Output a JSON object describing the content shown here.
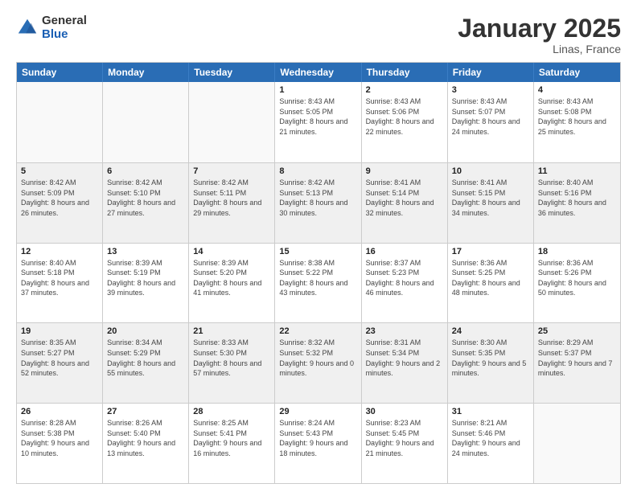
{
  "logo": {
    "general": "General",
    "blue": "Blue"
  },
  "title": {
    "month": "January 2025",
    "location": "Linas, France"
  },
  "header_days": [
    "Sunday",
    "Monday",
    "Tuesday",
    "Wednesday",
    "Thursday",
    "Friday",
    "Saturday"
  ],
  "weeks": [
    [
      {
        "day": "",
        "info": ""
      },
      {
        "day": "",
        "info": ""
      },
      {
        "day": "",
        "info": ""
      },
      {
        "day": "1",
        "info": "Sunrise: 8:43 AM\nSunset: 5:05 PM\nDaylight: 8 hours and 21 minutes."
      },
      {
        "day": "2",
        "info": "Sunrise: 8:43 AM\nSunset: 5:06 PM\nDaylight: 8 hours and 22 minutes."
      },
      {
        "day": "3",
        "info": "Sunrise: 8:43 AM\nSunset: 5:07 PM\nDaylight: 8 hours and 24 minutes."
      },
      {
        "day": "4",
        "info": "Sunrise: 8:43 AM\nSunset: 5:08 PM\nDaylight: 8 hours and 25 minutes."
      }
    ],
    [
      {
        "day": "5",
        "info": "Sunrise: 8:42 AM\nSunset: 5:09 PM\nDaylight: 8 hours and 26 minutes."
      },
      {
        "day": "6",
        "info": "Sunrise: 8:42 AM\nSunset: 5:10 PM\nDaylight: 8 hours and 27 minutes."
      },
      {
        "day": "7",
        "info": "Sunrise: 8:42 AM\nSunset: 5:11 PM\nDaylight: 8 hours and 29 minutes."
      },
      {
        "day": "8",
        "info": "Sunrise: 8:42 AM\nSunset: 5:13 PM\nDaylight: 8 hours and 30 minutes."
      },
      {
        "day": "9",
        "info": "Sunrise: 8:41 AM\nSunset: 5:14 PM\nDaylight: 8 hours and 32 minutes."
      },
      {
        "day": "10",
        "info": "Sunrise: 8:41 AM\nSunset: 5:15 PM\nDaylight: 8 hours and 34 minutes."
      },
      {
        "day": "11",
        "info": "Sunrise: 8:40 AM\nSunset: 5:16 PM\nDaylight: 8 hours and 36 minutes."
      }
    ],
    [
      {
        "day": "12",
        "info": "Sunrise: 8:40 AM\nSunset: 5:18 PM\nDaylight: 8 hours and 37 minutes."
      },
      {
        "day": "13",
        "info": "Sunrise: 8:39 AM\nSunset: 5:19 PM\nDaylight: 8 hours and 39 minutes."
      },
      {
        "day": "14",
        "info": "Sunrise: 8:39 AM\nSunset: 5:20 PM\nDaylight: 8 hours and 41 minutes."
      },
      {
        "day": "15",
        "info": "Sunrise: 8:38 AM\nSunset: 5:22 PM\nDaylight: 8 hours and 43 minutes."
      },
      {
        "day": "16",
        "info": "Sunrise: 8:37 AM\nSunset: 5:23 PM\nDaylight: 8 hours and 46 minutes."
      },
      {
        "day": "17",
        "info": "Sunrise: 8:36 AM\nSunset: 5:25 PM\nDaylight: 8 hours and 48 minutes."
      },
      {
        "day": "18",
        "info": "Sunrise: 8:36 AM\nSunset: 5:26 PM\nDaylight: 8 hours and 50 minutes."
      }
    ],
    [
      {
        "day": "19",
        "info": "Sunrise: 8:35 AM\nSunset: 5:27 PM\nDaylight: 8 hours and 52 minutes."
      },
      {
        "day": "20",
        "info": "Sunrise: 8:34 AM\nSunset: 5:29 PM\nDaylight: 8 hours and 55 minutes."
      },
      {
        "day": "21",
        "info": "Sunrise: 8:33 AM\nSunset: 5:30 PM\nDaylight: 8 hours and 57 minutes."
      },
      {
        "day": "22",
        "info": "Sunrise: 8:32 AM\nSunset: 5:32 PM\nDaylight: 9 hours and 0 minutes."
      },
      {
        "day": "23",
        "info": "Sunrise: 8:31 AM\nSunset: 5:34 PM\nDaylight: 9 hours and 2 minutes."
      },
      {
        "day": "24",
        "info": "Sunrise: 8:30 AM\nSunset: 5:35 PM\nDaylight: 9 hours and 5 minutes."
      },
      {
        "day": "25",
        "info": "Sunrise: 8:29 AM\nSunset: 5:37 PM\nDaylight: 9 hours and 7 minutes."
      }
    ],
    [
      {
        "day": "26",
        "info": "Sunrise: 8:28 AM\nSunset: 5:38 PM\nDaylight: 9 hours and 10 minutes."
      },
      {
        "day": "27",
        "info": "Sunrise: 8:26 AM\nSunset: 5:40 PM\nDaylight: 9 hours and 13 minutes."
      },
      {
        "day": "28",
        "info": "Sunrise: 8:25 AM\nSunset: 5:41 PM\nDaylight: 9 hours and 16 minutes."
      },
      {
        "day": "29",
        "info": "Sunrise: 8:24 AM\nSunset: 5:43 PM\nDaylight: 9 hours and 18 minutes."
      },
      {
        "day": "30",
        "info": "Sunrise: 8:23 AM\nSunset: 5:45 PM\nDaylight: 9 hours and 21 minutes."
      },
      {
        "day": "31",
        "info": "Sunrise: 8:21 AM\nSunset: 5:46 PM\nDaylight: 9 hours and 24 minutes."
      },
      {
        "day": "",
        "info": ""
      }
    ]
  ]
}
